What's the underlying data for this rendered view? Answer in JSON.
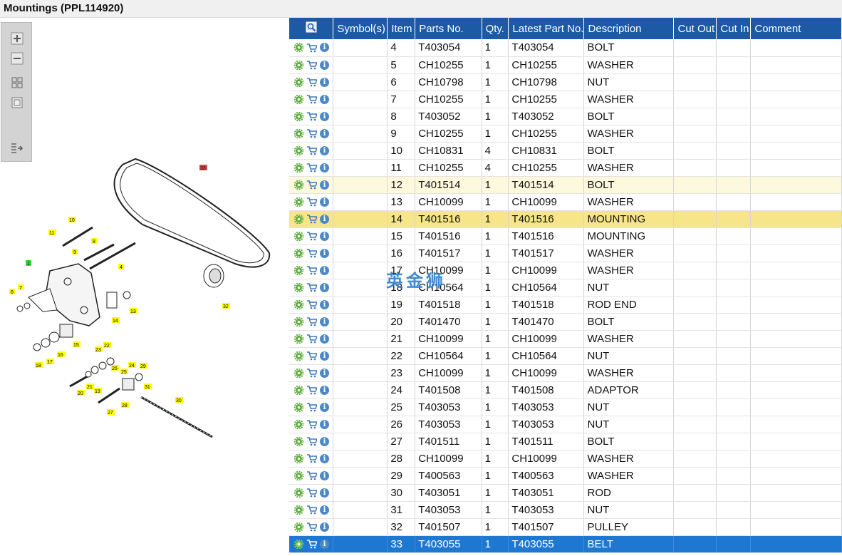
{
  "window": {
    "title": "Mountings (PPL114920)"
  },
  "toolbar": {
    "buttons": [
      {
        "icon": "zoom-in-icon"
      },
      {
        "icon": "zoom-out-icon"
      },
      {
        "icon": "fit-all-icon"
      },
      {
        "icon": "fit-window-icon"
      },
      {
        "icon": "export-icon"
      }
    ]
  },
  "diagram": {
    "callouts": [
      "33",
      "10",
      "11",
      "8",
      "9",
      "4",
      "1",
      "7",
      "6",
      "14",
      "13",
      "32",
      "15",
      "16",
      "17",
      "18",
      "23",
      "22",
      "26",
      "25",
      "24",
      "29",
      "31",
      "21",
      "19",
      "20",
      "27",
      "28",
      "30"
    ],
    "highlight_color": "#ffff00",
    "red_callout_color": "#e34c4c",
    "green_callout_color": "#3cd23c"
  },
  "watermark": "英金狮",
  "table": {
    "columns": [
      "",
      "Symbol(s)",
      "Item",
      "Parts No.",
      "Qty.",
      "Latest Part No.",
      "Description",
      "Cut Out",
      "Cut In",
      "Comment"
    ],
    "rows": [
      {
        "item": "4",
        "part": "T403054",
        "qty": "1",
        "latest": "T403054",
        "desc": "BOLT"
      },
      {
        "item": "5",
        "part": "CH10255",
        "qty": "1",
        "latest": "CH10255",
        "desc": "WASHER"
      },
      {
        "item": "6",
        "part": "CH10798",
        "qty": "1",
        "latest": "CH10798",
        "desc": "NUT"
      },
      {
        "item": "7",
        "part": "CH10255",
        "qty": "1",
        "latest": "CH10255",
        "desc": "WASHER"
      },
      {
        "item": "8",
        "part": "T403052",
        "qty": "1",
        "latest": "T403052",
        "desc": "BOLT"
      },
      {
        "item": "9",
        "part": "CH10255",
        "qty": "1",
        "latest": "CH10255",
        "desc": "WASHER"
      },
      {
        "item": "10",
        "part": "CH10831",
        "qty": "4",
        "latest": "CH10831",
        "desc": "BOLT"
      },
      {
        "item": "11",
        "part": "CH10255",
        "qty": "4",
        "latest": "CH10255",
        "desc": "WASHER"
      },
      {
        "item": "12",
        "part": "T401514",
        "qty": "1",
        "latest": "T401514",
        "desc": "BOLT",
        "state": "hl-light"
      },
      {
        "item": "13",
        "part": "CH10099",
        "qty": "1",
        "latest": "CH10099",
        "desc": "WASHER"
      },
      {
        "item": "14",
        "part": "T401516",
        "qty": "1",
        "latest": "T401516",
        "desc": "MOUNTING",
        "state": "hl"
      },
      {
        "item": "15",
        "part": "T401516",
        "qty": "1",
        "latest": "T401516",
        "desc": "MOUNTING"
      },
      {
        "item": "16",
        "part": "T401517",
        "qty": "1",
        "latest": "T401517",
        "desc": "WASHER"
      },
      {
        "item": "17",
        "part": "CH10099",
        "qty": "1",
        "latest": "CH10099",
        "desc": "WASHER"
      },
      {
        "item": "18",
        "part": "CH10564",
        "qty": "1",
        "latest": "CH10564",
        "desc": "NUT"
      },
      {
        "item": "19",
        "part": "T401518",
        "qty": "1",
        "latest": "T401518",
        "desc": "ROD END"
      },
      {
        "item": "20",
        "part": "T401470",
        "qty": "1",
        "latest": "T401470",
        "desc": "BOLT"
      },
      {
        "item": "21",
        "part": "CH10099",
        "qty": "1",
        "latest": "CH10099",
        "desc": "WASHER"
      },
      {
        "item": "22",
        "part": "CH10564",
        "qty": "1",
        "latest": "CH10564",
        "desc": "NUT"
      },
      {
        "item": "23",
        "part": "CH10099",
        "qty": "1",
        "latest": "CH10099",
        "desc": "WASHER"
      },
      {
        "item": "24",
        "part": "T401508",
        "qty": "1",
        "latest": "T401508",
        "desc": "ADAPTOR"
      },
      {
        "item": "25",
        "part": "T403053",
        "qty": "1",
        "latest": "T403053",
        "desc": "NUT"
      },
      {
        "item": "26",
        "part": "T403053",
        "qty": "1",
        "latest": "T403053",
        "desc": "NUT"
      },
      {
        "item": "27",
        "part": "T401511",
        "qty": "1",
        "latest": "T401511",
        "desc": "BOLT"
      },
      {
        "item": "28",
        "part": "CH10099",
        "qty": "1",
        "latest": "CH10099",
        "desc": "WASHER"
      },
      {
        "item": "29",
        "part": "T400563",
        "qty": "1",
        "latest": "T400563",
        "desc": "WASHER"
      },
      {
        "item": "30",
        "part": "T403051",
        "qty": "1",
        "latest": "T403051",
        "desc": "ROD"
      },
      {
        "item": "31",
        "part": "T403053",
        "qty": "1",
        "latest": "T403053",
        "desc": "NUT"
      },
      {
        "item": "32",
        "part": "T401507",
        "qty": "1",
        "latest": "T401507",
        "desc": "PULLEY"
      },
      {
        "item": "33",
        "part": "T403055",
        "qty": "1",
        "latest": "T403055",
        "desc": "BELT",
        "state": "sel"
      }
    ],
    "row_icons": [
      "gear-icon",
      "cart-icon",
      "info-icon"
    ],
    "colors": {
      "header": "#1c5aa6",
      "selected": "#1e78d2",
      "highlight": "#f7e58a",
      "highlight_light": "#fdf9dc"
    }
  }
}
